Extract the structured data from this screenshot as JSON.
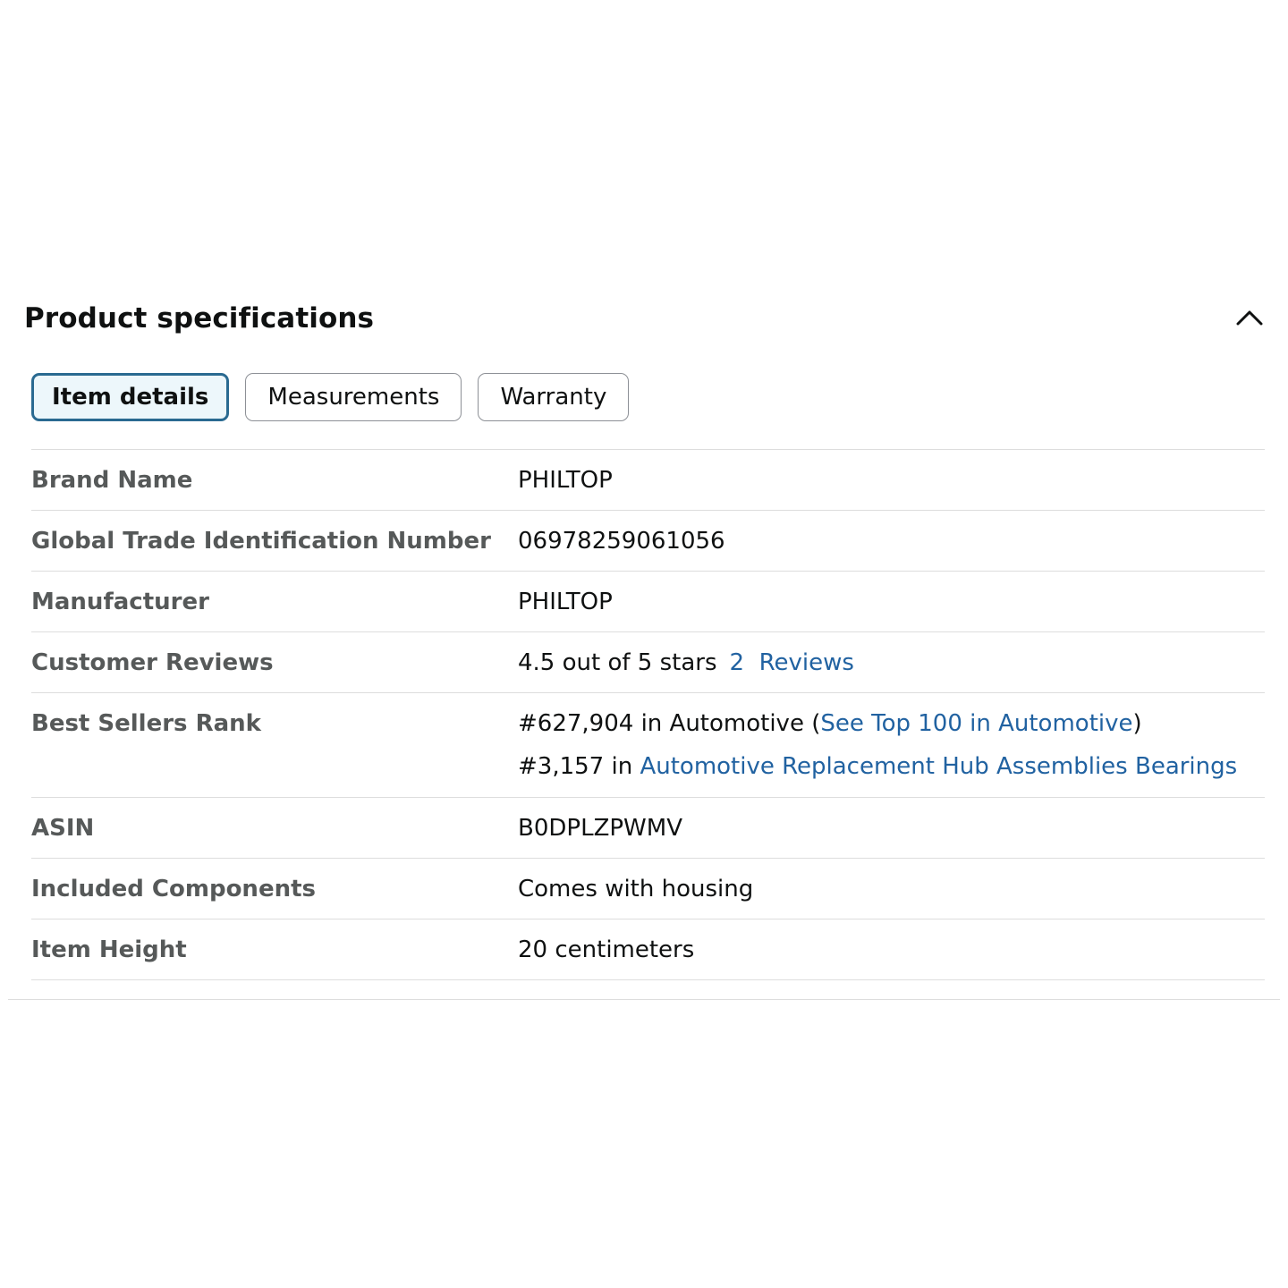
{
  "section": {
    "title": "Product specifications",
    "collapse_icon": "chevron-up-icon"
  },
  "tabs": [
    {
      "label": "Item details",
      "active": true
    },
    {
      "label": "Measurements",
      "active": false
    },
    {
      "label": "Warranty",
      "active": false
    }
  ],
  "specs": {
    "brand_name": {
      "label": "Brand Name",
      "value": "PHILTOP"
    },
    "gtin": {
      "label": "Global Trade Identification Number",
      "value": "06978259061056"
    },
    "manufacturer": {
      "label": "Manufacturer",
      "value": "PHILTOP"
    },
    "customer_reviews": {
      "label": "Customer Reviews",
      "rating_text": "4.5 out of 5 stars",
      "reviews_link": "2  Reviews"
    },
    "best_sellers_rank": {
      "label": "Best Sellers Rank",
      "rank1_text": "#627,904 in Automotive (",
      "rank1_link": "See Top 100 in Automotive",
      "rank1_close": ")",
      "rank2_text": "#3,157 in ",
      "rank2_link": "Automotive Replacement Hub Assemblies Bearings"
    },
    "asin": {
      "label": "ASIN",
      "value": "B0DPLZPWMV"
    },
    "included_components": {
      "label": "Included Components",
      "value": "Comes with housing"
    },
    "item_height": {
      "label": "Item Height",
      "value": "20 centimeters"
    }
  },
  "colors": {
    "link": "#2162a1",
    "label": "#565959",
    "text": "#0f1111",
    "active_tab_border": "#2a6a91",
    "active_tab_bg": "#edf7fb"
  }
}
